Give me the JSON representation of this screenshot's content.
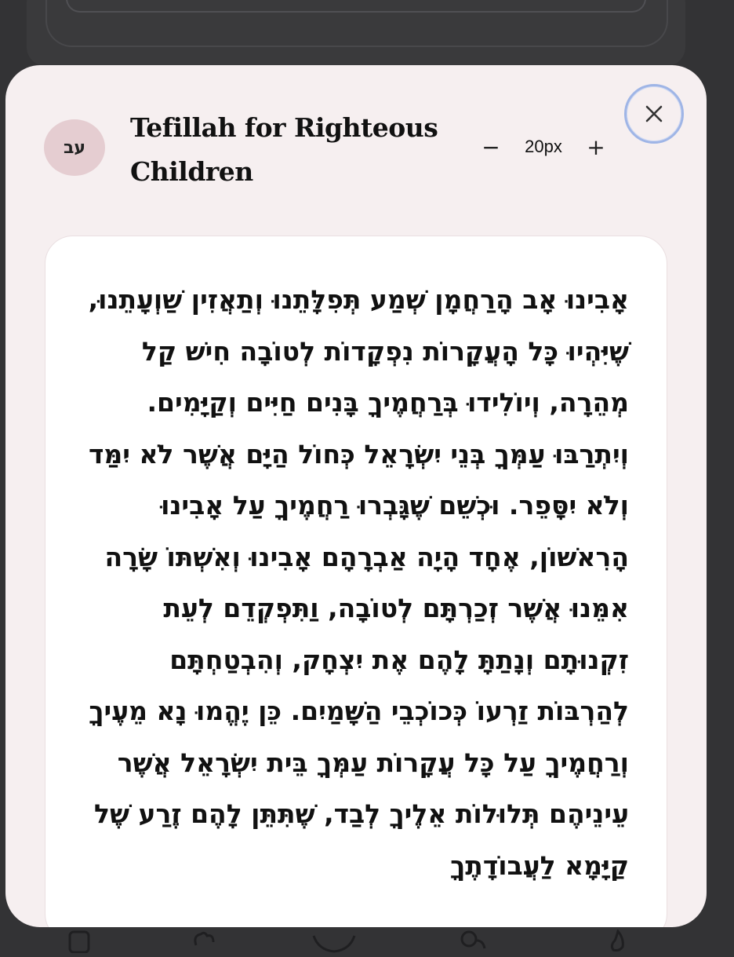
{
  "modal": {
    "language_badge": "עב",
    "title": "Tefillah for Righteous Children",
    "font_size": {
      "decrease_label": "−",
      "value": "20px",
      "increase_label": "+"
    },
    "close_icon": "close-icon"
  },
  "prayer": {
    "text": "אָבִינוּ אָב הָרַחֲמָן שְׁמַע תְּפִלָּתֵנוּ וְתַאֲזִין שַׁוְעָתֵנוּ, שֶׁיִּהְיוּ כָּל הָעֲקָרוֹת נִפְקָדוֹת לְטוֹבָה חִישׁ קַל מְהֵרָה, וְיוֹלִידוּ בְּרַחֲמֶיךָ בָּנִים חַיִּים וְקַיָּמִים. וְיִתְרַבּוּ עַמְּךָ בְּנֵי יִשְׂרָאֵל כְּחוֹל הַיָּם אֲשֶׁר לֹא יִמַּד וְלֹא יִסָּפֵר. וּכְשֵׁם שֶׁגָּבְרוּ רַחֲמֶיךָ עַל אָבִינוּ הָרִאשׁוֹן, אֶחָד הָיָה אַבְרָהָם אָבִינוּ וְאִשְׁתּוֹ שָׂרָה אִמֵּנוּ אֲשֶׁר זְכַרְתָּם לְטוֹבָה, וַתִּפְקְדֵם לְעֵת זִקְנוּתָם וְנָתַתָּ לָהֶם אֶת יִצְחָק, וְהִבְטַחְתָּם לְהַרְבּוֹת זַרְעוֹ כְּכוֹכְבֵי הַשָּׁמַיִם. כֵּן יֶהֱמוּ נָא מֵעֶיךָ וְרַחֲמֶיךָ עַל כָּל עֲקָרוֹת עַמְּךָ בֵּית יִשְׂרָאֵל אֲשֶׁר עֵינֵיהֶם תְּלוּלוֹת אֵלֶיךָ לְבַד, שֶׁתִּתֵּן לָהֶם זֶרַע שֶׁל קַיָּמָא לַעֲבוֹדָתֶךָ"
  },
  "bottom_nav": {
    "icons": [
      "bookmark-icon",
      "heart-hands-icon",
      "heart-icon",
      "user-group-icon",
      "flame-icon"
    ]
  }
}
